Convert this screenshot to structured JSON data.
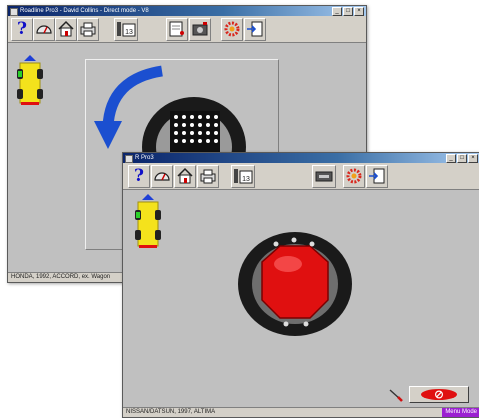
{
  "back_window": {
    "title": "Roadline Pro3 - David Collins - Direct mode - V8",
    "status_text": "HONDA, 1992, ACCORD, ex. Wagon"
  },
  "front_window": {
    "title": "R Pro3",
    "status_text": "NISSAN/DATSUN, 1997, ALTIMA",
    "mode_badge": "Menu Mode"
  },
  "toolbar": {
    "help_label": "?",
    "calendar_label": "13"
  },
  "colors": {
    "title_bar": "#0a246a",
    "rotate_arrow": "#1b4fd0",
    "target_red": "#e01010",
    "vehicle_yellow": "#f4e21c",
    "mode_badge": "#9b1fd1"
  }
}
